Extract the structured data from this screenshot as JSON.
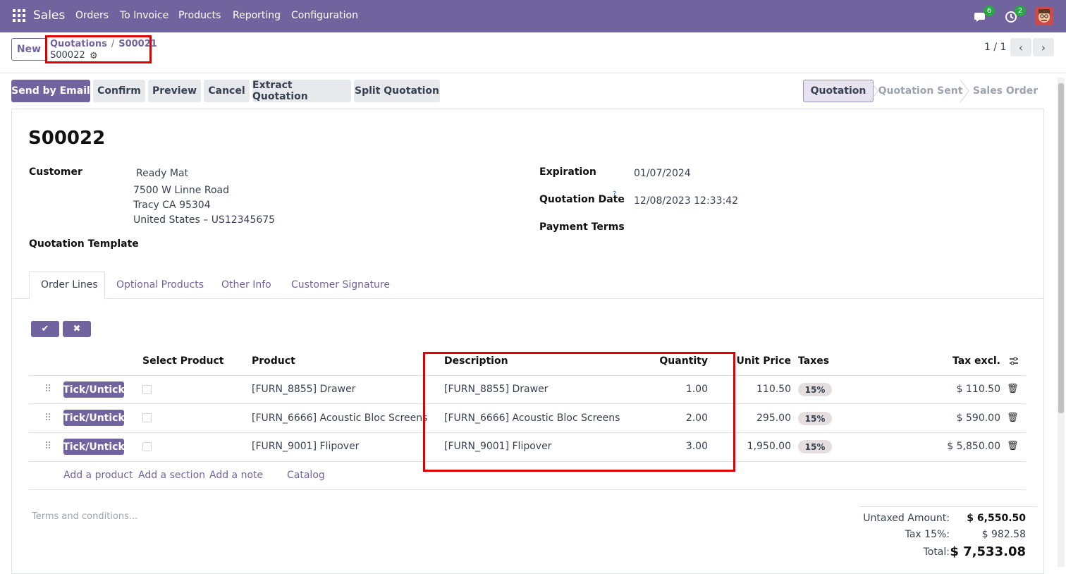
{
  "nav": {
    "app": "Sales",
    "menu": [
      "Orders",
      "To Invoice",
      "Products",
      "Reporting",
      "Configuration"
    ],
    "messages_count": "6",
    "activities_count": "2"
  },
  "control": {
    "new_label": "New",
    "breadcrumb_parent": "Quotations",
    "breadcrumb_sep": "/",
    "breadcrumb_prev": "S00021",
    "breadcrumb_current": "S00022",
    "pager": "1 / 1"
  },
  "actions": {
    "send_email": "Send by Email",
    "confirm": "Confirm",
    "preview": "Preview",
    "cancel": "Cancel",
    "extract": "Extract Quotation",
    "split": "Split Quotation"
  },
  "statusbar": [
    "Quotation",
    "Quotation Sent",
    "Sales Order"
  ],
  "form": {
    "title": "S00022",
    "customer_label": "Customer",
    "customer_name": "Ready Mat",
    "address1": "7500 W Linne Road",
    "address2": "Tracy CA 95304",
    "address3": "United States – US12345675",
    "template_label": "Quotation Template",
    "expiration_label": "Expiration",
    "expiration_value": "01/07/2024",
    "qdate_label": "Quotation Date",
    "qdate_help": "?",
    "qdate_value": "12/08/2023 12:33:42",
    "payment_label": "Payment Terms"
  },
  "tabs": [
    "Order Lines",
    "Optional Products",
    "Other Info",
    "Customer Signature"
  ],
  "table": {
    "headers": {
      "select": "Select Product",
      "product": "Product",
      "description": "Description",
      "quantity": "Quantity",
      "unit_price": "Unit Price",
      "taxes": "Taxes",
      "tax_excl": "Tax excl."
    },
    "tick_label": "Tick/Untick",
    "rows": [
      {
        "product": "[FURN_8855] Drawer",
        "description": "[FURN_8855] Drawer",
        "quantity": "1.00",
        "unit_price": "110.50",
        "tax": "15%",
        "subtotal": "$ 110.50"
      },
      {
        "product": "[FURN_6666] Acoustic Bloc Screens",
        "description": "[FURN_6666] Acoustic Bloc Screens",
        "quantity": "2.00",
        "unit_price": "295.00",
        "tax": "15%",
        "subtotal": "$ 590.00"
      },
      {
        "product": "[FURN_9001] Flipover",
        "description": "[FURN_9001] Flipover",
        "quantity": "3.00",
        "unit_price": "1,950.00",
        "tax": "15%",
        "subtotal": "$ 5,850.00"
      }
    ],
    "links": [
      "Add a product",
      "Add a section",
      "Add a note",
      "Catalog"
    ]
  },
  "footer": {
    "terms_placeholder": "Terms and conditions...",
    "untaxed_label": "Untaxed Amount:",
    "untaxed_value": "$ 6,550.50",
    "tax_label": "Tax 15%:",
    "tax_value": "$ 982.58",
    "total_label": "Total:",
    "total_value": "$ 7,533.08"
  },
  "colors": {
    "brand": "#71639e",
    "highlight": "#e00000"
  }
}
